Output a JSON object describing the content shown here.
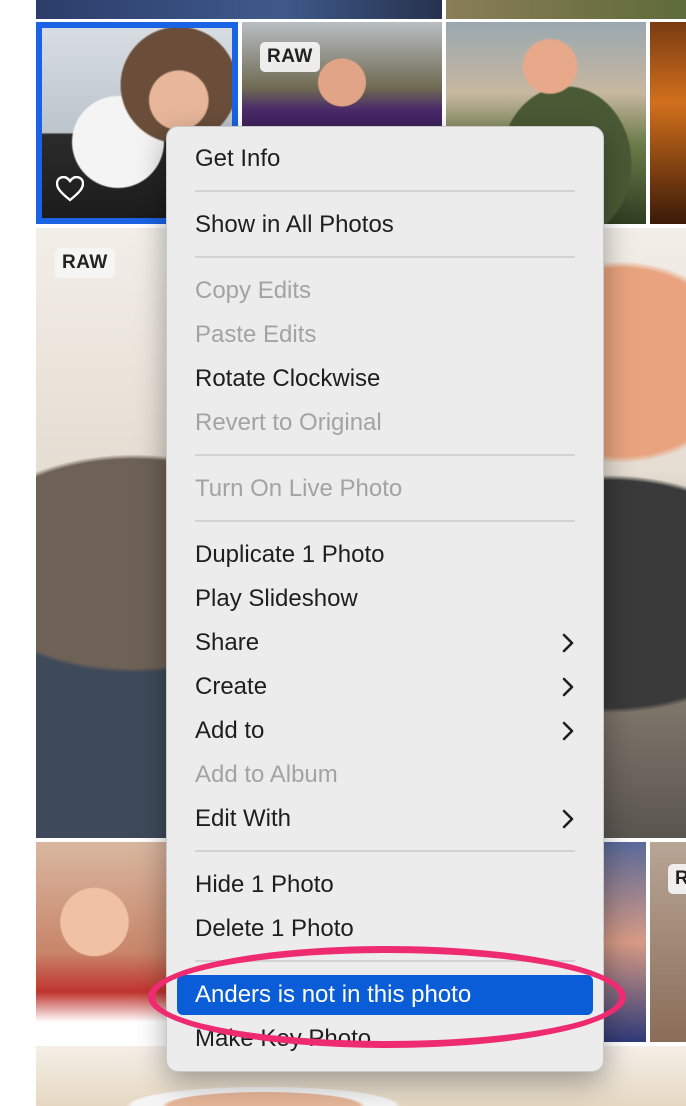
{
  "grid": {
    "badges": [
      "RAW",
      "RAW",
      "R"
    ]
  },
  "colors": {
    "selection_border": "#1a63e5",
    "menu_background": "#ececec",
    "highlight": "#0a5cd7",
    "annotation_ring": "#ee2a70"
  },
  "menu": {
    "items": [
      {
        "label": "Get Info",
        "enabled": true
      },
      {
        "label": "Show in All Photos",
        "enabled": true
      },
      {
        "label": "Copy Edits",
        "enabled": false
      },
      {
        "label": "Paste Edits",
        "enabled": false
      },
      {
        "label": "Rotate Clockwise",
        "enabled": true
      },
      {
        "label": "Revert to Original",
        "enabled": false
      },
      {
        "label": "Turn On Live Photo",
        "enabled": false
      },
      {
        "label": "Duplicate 1 Photo",
        "enabled": true
      },
      {
        "label": "Play Slideshow",
        "enabled": true
      },
      {
        "label": "Share",
        "enabled": true,
        "submenu": true
      },
      {
        "label": "Create",
        "enabled": true,
        "submenu": true
      },
      {
        "label": "Add to",
        "enabled": true,
        "submenu": true
      },
      {
        "label": "Add to Album",
        "enabled": false
      },
      {
        "label": "Edit With",
        "enabled": true,
        "submenu": true
      },
      {
        "label": "Hide 1 Photo",
        "enabled": true
      },
      {
        "label": "Delete 1 Photo",
        "enabled": true
      },
      {
        "label": "Anders is not in this photo",
        "enabled": true,
        "highlighted": true
      },
      {
        "label": "Make Key Photo",
        "enabled": true
      }
    ]
  }
}
